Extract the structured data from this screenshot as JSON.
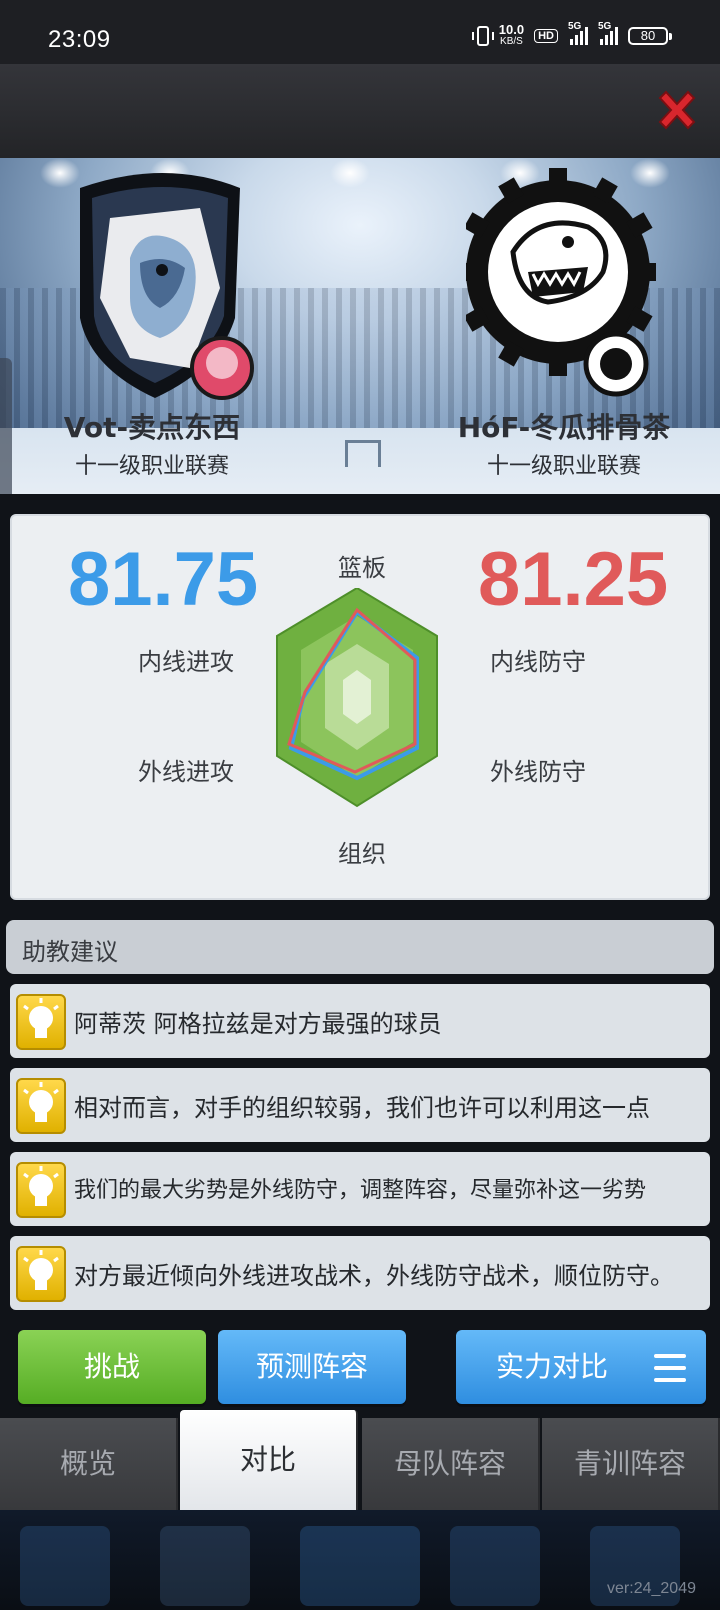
{
  "status_bar": {
    "time": "23:09",
    "net_speed": "10.0",
    "net_unit": "KB/S",
    "hd": "HD",
    "signal1": "5G",
    "signal2": "5G",
    "battery": "80"
  },
  "teams": {
    "home": {
      "name": "Vot-卖点东西",
      "league": "十一级职业联赛",
      "score": "81.75",
      "color": "#3c9be8"
    },
    "away": {
      "name": "HóF-冬瓜排骨茶",
      "league": "十一级职业联赛",
      "score": "81.25",
      "color": "#e05a5a"
    }
  },
  "radar": {
    "axes": {
      "top": "篮板",
      "upper_left": "内线进攻",
      "lower_left": "外线进攻",
      "upper_right": "内线防守",
      "lower_right": "外线防守",
      "bottom": "组织"
    }
  },
  "advice": {
    "title": "助教建议",
    "items": [
      "阿蒂茨 阿格拉兹是对方最强的球员",
      "相对而言，对手的组织较弱，我们也许可以利用这一点",
      "我们的最大劣势是外线防守，调整阵容，尽量弥补这一劣势",
      "对方最近倾向外线进攻战术，外线防守战术，顺位防守。"
    ]
  },
  "actions": {
    "challenge": "挑战",
    "predict": "预测阵容",
    "strength": "实力对比"
  },
  "tabs": [
    "概览",
    "对比",
    "母队阵容",
    "青训阵容"
  ],
  "version": "ver:24_2049"
}
